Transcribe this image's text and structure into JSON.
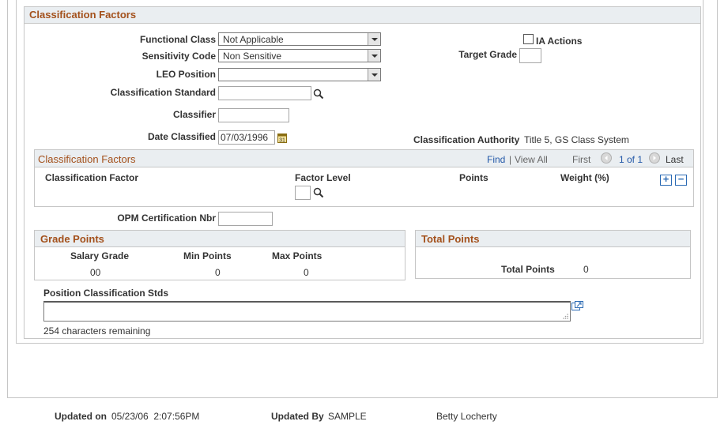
{
  "section_title": "Classification Factors",
  "fields": {
    "functional_class": {
      "label": "Functional Class",
      "value": "Not Applicable"
    },
    "sensitivity_code": {
      "label": "Sensitivity Code",
      "value": "Non Sensitive"
    },
    "leo_position": {
      "label": "LEO Position",
      "value": ""
    },
    "classification_standard": {
      "label": "Classification Standard",
      "value": ""
    },
    "classifier": {
      "label": "Classifier",
      "value": ""
    },
    "date_classified": {
      "label": "Date Classified",
      "value": "07/03/1996"
    },
    "ia_actions": {
      "label": "IA Actions",
      "checked": false
    },
    "target_grade": {
      "label": "Target Grade",
      "value": ""
    },
    "classification_authority": {
      "label": "Classification Authority",
      "value": "Title 5, GS Class System"
    },
    "opm_certification_nbr": {
      "label": "OPM Certification Nbr",
      "value": ""
    }
  },
  "factors_grid": {
    "title": "Classification Factors",
    "find": "Find",
    "separator": "|",
    "view_all": "View All",
    "first": "First",
    "page_info": "1 of 1",
    "last": "Last",
    "columns": [
      "Classification Factor",
      "Factor Level",
      "Points",
      "Weight (%)"
    ],
    "factor_level_value": "",
    "add_symbol": "+",
    "remove_symbol": "−"
  },
  "grade_points": {
    "title": "Grade Points",
    "columns": [
      "Salary Grade",
      "Min Points",
      "Max Points"
    ],
    "values": [
      "00",
      "0",
      "0"
    ]
  },
  "total_points": {
    "title": "Total Points",
    "label": "Total Points",
    "value": "0"
  },
  "position_stds": {
    "label": "Position Classification Stds",
    "value": "",
    "remaining": "254 characters remaining"
  },
  "footer": {
    "updated_on_label": "Updated on",
    "updated_on_value": "05/23/06  2:07:56PM",
    "updated_by_label": "Updated By",
    "updated_by_value": "SAMPLE",
    "updated_by_name": "Betty Locherty"
  },
  "colors": {
    "section_title": "#a3501b",
    "link": "#2358a8",
    "header_bg": "#eaeef1"
  }
}
